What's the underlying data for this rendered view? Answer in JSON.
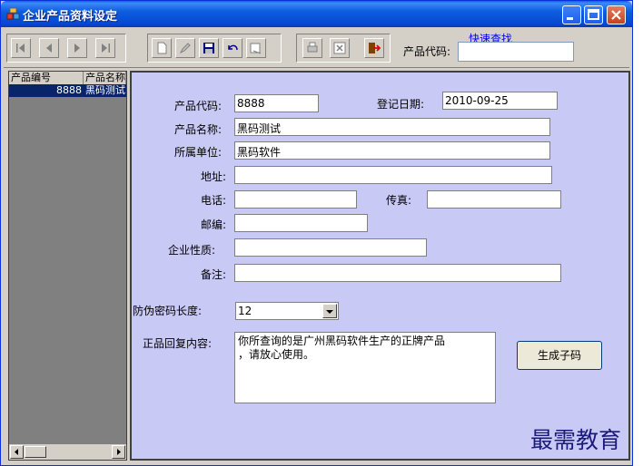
{
  "window": {
    "title": "企业产品资料设定"
  },
  "toolbar": {
    "quick_search_label": "快速查找",
    "product_code_label": "产品代码:",
    "product_code_value": ""
  },
  "list": {
    "columns": [
      "产品编号",
      "产品名称"
    ],
    "rows": [
      {
        "code": "8888",
        "name": "黑码测试"
      }
    ]
  },
  "form": {
    "product_code_label": "产品代码:",
    "product_code_value": "8888",
    "reg_date_label": "登记日期:",
    "reg_date_value": "2010-09-25",
    "product_name_label": "产品名称:",
    "product_name_value": "黑码测试",
    "unit_label": "所属单位:",
    "unit_value": "黑码软件",
    "address_label": "地址:",
    "address_value": "",
    "phone_label": "电话:",
    "phone_value": "",
    "fax_label": "传真:",
    "fax_value": "",
    "zip_label": "邮编:",
    "zip_value": "",
    "nature_label": "企业性质:",
    "nature_value": "",
    "remark_label": "备注:",
    "remark_value": "",
    "code_length_label": "防伪密码长度:",
    "code_length_value": "12",
    "reply_label": "正品回复内容:",
    "reply_value": "你所查询的是广州黑码软件生产的正牌产品\n，请放心使用。",
    "generate_button": "生成子码"
  },
  "watermark": "最需教育"
}
